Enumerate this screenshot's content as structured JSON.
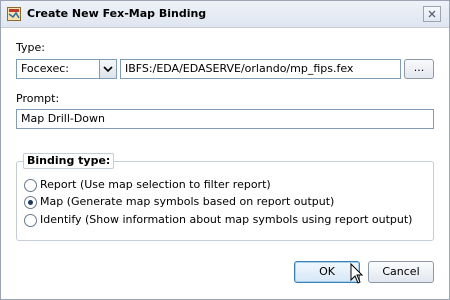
{
  "window": {
    "title": "Create New Fex-Map Binding",
    "icon": "map-binding-icon",
    "close_icon": "close-icon"
  },
  "type_field": {
    "label": "Type:",
    "selected": "Focexec:",
    "path": "IBFS:/EDA/EDASERVE/orlando/mp_fips.fex",
    "browse_label": "..."
  },
  "prompt_field": {
    "label": "Prompt:",
    "value": "Map Drill-Down"
  },
  "binding_type": {
    "legend": "Binding type:",
    "options": [
      {
        "label": "Report (Use map selection to filter report)",
        "selected": false
      },
      {
        "label": "Map (Generate map symbols based on report output)",
        "selected": true
      },
      {
        "label": "Identify (Show information about map symbols using report output)",
        "selected": false
      }
    ]
  },
  "buttons": {
    "ok_label": "OK",
    "cancel_label": "Cancel"
  },
  "colors": {
    "accent": "#3c7fb1",
    "border": "#7f9db9"
  }
}
